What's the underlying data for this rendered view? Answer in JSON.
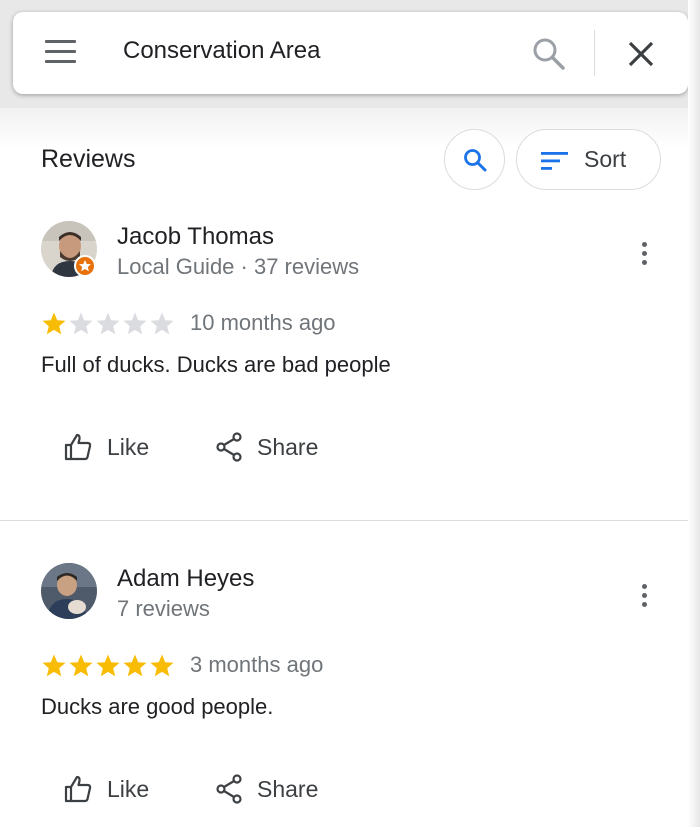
{
  "search": {
    "query": "Conservation Area",
    "menu_icon": "hamburger-menu-icon",
    "search_icon": "search-icon",
    "close_icon": "close-icon"
  },
  "reviews_panel": {
    "title": "Reviews",
    "sort_label": "Sort"
  },
  "reviews": [
    {
      "author": "Jacob Thomas",
      "meta": "Local Guide · 37 reviews",
      "rating": 1,
      "max_rating": 5,
      "time": "10 months ago",
      "text": "Full of ducks. Ducks are bad people",
      "like_label": "Like",
      "share_label": "Share",
      "local_guide_badge": true
    },
    {
      "author": "Adam Heyes",
      "meta": "7 reviews",
      "rating": 5,
      "max_rating": 5,
      "time": "3 months ago",
      "text": "Ducks are good people.",
      "like_label": "Like",
      "share_label": "Share",
      "local_guide_badge": false
    }
  ],
  "colors": {
    "star_filled": "#f9bc05",
    "star_empty": "#dadce0",
    "accent_blue": "#1a73e8",
    "badge_orange": "#e8710a"
  }
}
